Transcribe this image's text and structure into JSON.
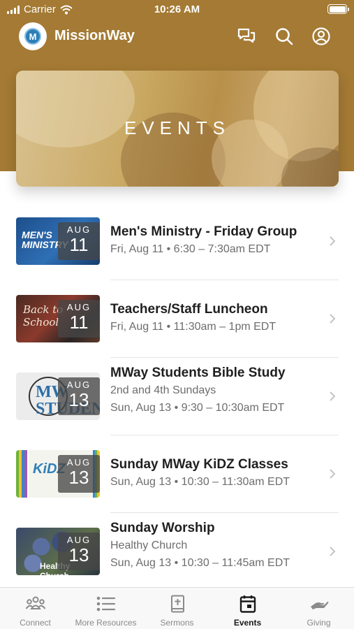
{
  "status_bar": {
    "carrier": "Carrier",
    "time": "10:26 AM"
  },
  "app": {
    "title": "MissionWay",
    "logo_letter": "M"
  },
  "header_icons": [
    "chat-icon",
    "search-icon",
    "account-icon"
  ],
  "hero": {
    "title": "EVENTS"
  },
  "events": [
    {
      "title": "Men's Ministry - Friday Group",
      "lines": [
        "Fri, Aug 11 • 6:30 – 7:30am EDT"
      ],
      "month": "AUG",
      "day": "11",
      "thumb_text": "MEN'S MINISTRY"
    },
    {
      "title": "Teachers/Staff Luncheon",
      "lines": [
        "Fri, Aug 11 • 11:30am – 1pm EDT"
      ],
      "month": "AUG",
      "day": "11",
      "thumb_text": "Back to School"
    },
    {
      "title": "MWay Students Bible Study",
      "lines": [
        "2nd and 4th Sundays",
        "Sun, Aug 13 • 9:30 – 10:30am EDT"
      ],
      "month": "AUG",
      "day": "13",
      "thumb_text": "MW STUDENTS"
    },
    {
      "title": "Sunday MWay KiDZ Classes",
      "lines": [
        "Sun, Aug 13 • 10:30 – 11:30am EDT"
      ],
      "month": "AUG",
      "day": "13",
      "thumb_text": "KiDZ"
    },
    {
      "title": "Sunday Worship",
      "lines": [
        "Healthy Church",
        "Sun, Aug 13 • 10:30 – 11:45am EDT"
      ],
      "month": "AUG",
      "day": "13",
      "thumb_text": "Healthy Church"
    }
  ],
  "tabs": [
    {
      "label": "Connect",
      "icon": "people-icon",
      "active": false
    },
    {
      "label": "More Resources",
      "icon": "list-icon",
      "active": false
    },
    {
      "label": "Sermons",
      "icon": "bible-icon",
      "active": false
    },
    {
      "label": "Events",
      "icon": "calendar-icon",
      "active": true
    },
    {
      "label": "Giving",
      "icon": "giving-hand-icon",
      "active": false
    }
  ],
  "colors": {
    "brand": "#a47a34",
    "text_primary": "#1f1f1f",
    "text_secondary": "#6d6d6d",
    "tab_inactive": "#8a8a8a"
  }
}
